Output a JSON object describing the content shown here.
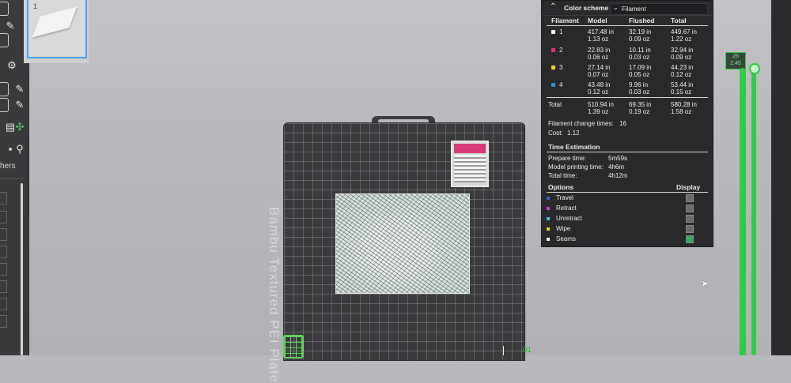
{
  "thumbnail": {
    "plate_number": "1"
  },
  "sidebar": {
    "partial_label": "hers"
  },
  "plate": {
    "name": "Bambu Textured PEI Plate",
    "plate_index": "01"
  },
  "panel": {
    "color_scheme_label": "Color scheme",
    "color_scheme_value": "Filament",
    "headers": [
      "Filament",
      "Model",
      "Flushed",
      "Total"
    ],
    "filaments": [
      {
        "id": "1",
        "color": "#f0f0f0",
        "model": [
          "417.48 in",
          "1.13 oz"
        ],
        "flushed": [
          "32.19 in",
          "0.09 oz"
        ],
        "total": [
          "449.67 in",
          "1.22 oz"
        ]
      },
      {
        "id": "2",
        "color": "#e0317a",
        "model": [
          "22.83 in",
          "0.06 oz"
        ],
        "flushed": [
          "10.11 in",
          "0.03 oz"
        ],
        "total": [
          "32.94 in",
          "0.09 oz"
        ]
      },
      {
        "id": "3",
        "color": "#f2d21a",
        "model": [
          "27.14 in",
          "0.07 oz"
        ],
        "flushed": [
          "17.09 in",
          "0.05 oz"
        ],
        "total": [
          "44.23 in",
          "0.12 oz"
        ]
      },
      {
        "id": "4",
        "color": "#2a8fe0",
        "model": [
          "43.48 in",
          "0.12 oz"
        ],
        "flushed": [
          "9.96 in",
          "0.03 oz"
        ],
        "total": [
          "53.44 in",
          "0.15 oz"
        ]
      }
    ],
    "total_label": "Total",
    "total": {
      "model": [
        "510.94 in",
        "1.39 oz"
      ],
      "flushed": [
        "69.35 in",
        "0.19 oz"
      ],
      "total": [
        "580.28 in",
        "1.58 oz"
      ]
    },
    "filament_change_label": "Filament change times:",
    "filament_change_value": "16",
    "cost_label": "Cost:",
    "cost_value": "1.12",
    "time_title": "Time Estimation",
    "prepare_label": "Prepare time:",
    "prepare_value": "5m59s",
    "model_time_label": "Model printing time:",
    "model_time_value": "4h6m",
    "total_time_label": "Total time:",
    "total_time_value": "4h12m",
    "options_label": "Options",
    "display_label": "Display",
    "options": [
      {
        "label": "Travel",
        "color": "#3d5bd8",
        "checked": false
      },
      {
        "label": "Retract",
        "color": "#d33ad6",
        "checked": false
      },
      {
        "label": "Unretract",
        "color": "#33c9d6",
        "checked": false
      },
      {
        "label": "Wipe",
        "color": "#e6dc1e",
        "checked": false
      },
      {
        "label": "Seams",
        "color": "#f2f2f2",
        "checked": true
      }
    ]
  },
  "layer_slider": {
    "layer": "26",
    "height": "2.45"
  }
}
